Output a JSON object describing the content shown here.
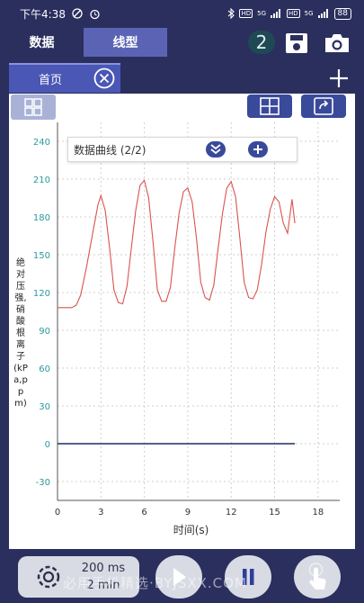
{
  "status_bar": {
    "time": "下午4:38",
    "net_1": "HD",
    "net_1_gen": "5G",
    "net_2": "HD",
    "net_2_gen": "5G",
    "battery": "88"
  },
  "topbar": {
    "tabs": [
      {
        "label": "数据"
      },
      {
        "label": "线型"
      }
    ],
    "badge_count": "2",
    "icons": [
      "save-icon",
      "camera-icon"
    ]
  },
  "pages": {
    "active_tab": "首页",
    "icons": [
      "close-circle-icon",
      "plus-icon"
    ]
  },
  "toolbar": {
    "icons": [
      "grid-icon",
      "layout-icon",
      "export-icon"
    ]
  },
  "legend": {
    "title": "数据曲线 (2/2)",
    "icons": [
      "double-chevron-down-icon",
      "plus-icon"
    ]
  },
  "chart_data": {
    "type": "line",
    "xlabel": "时间(s)",
    "ylabel": "绝对压强,硝酸根离子(kPa,ppm)",
    "xlim": [
      0,
      19.5
    ],
    "ylim": [
      -45,
      255
    ],
    "xticks": [
      "0",
      "3",
      "6",
      "9",
      "12",
      "15",
      "18"
    ],
    "yticks": [
      "-30",
      "0",
      "30",
      "60",
      "90",
      "120",
      "150",
      "180",
      "210",
      "240"
    ],
    "grid": true,
    "series": [
      {
        "color": "#d9534f",
        "x": [
          0,
          0.5,
          1.0,
          1.3,
          1.6,
          2.0,
          2.4,
          2.8,
          3.0,
          3.3,
          3.6,
          3.9,
          4.2,
          4.5,
          4.8,
          5.1,
          5.4,
          5.7,
          6.0,
          6.3,
          6.6,
          6.9,
          7.2,
          7.5,
          7.8,
          8.1,
          8.4,
          8.7,
          9.0,
          9.3,
          9.6,
          9.9,
          10.2,
          10.5,
          10.8,
          11.1,
          11.4,
          11.7,
          12.0,
          12.3,
          12.6,
          12.9,
          13.2,
          13.5,
          13.8,
          14.1,
          14.4,
          14.7,
          15.0,
          15.3,
          15.6,
          15.9,
          16.2,
          16.4
        ],
        "y": [
          108,
          108,
          108,
          110,
          118,
          140,
          165,
          190,
          197,
          185,
          155,
          122,
          112,
          111,
          125,
          155,
          185,
          205,
          209,
          195,
          160,
          122,
          113,
          113,
          124,
          155,
          183,
          200,
          203,
          192,
          163,
          128,
          116,
          114,
          126,
          155,
          183,
          203,
          208,
          196,
          163,
          128,
          116,
          115,
          122,
          142,
          168,
          186,
          196,
          192,
          175,
          167,
          194,
          175
        ]
      },
      {
        "color": "#1f2d66",
        "x": [
          0,
          16.4
        ],
        "y": [
          0,
          0
        ]
      }
    ]
  },
  "controls": {
    "sample_interval": "200 ms",
    "duration": "2 min",
    "icons": [
      "settings-gear-icon",
      "play-icon",
      "pause-icon",
      "tap-hand-icon"
    ]
  },
  "watermark": "必用手机精选·BYJSXX.COM"
}
